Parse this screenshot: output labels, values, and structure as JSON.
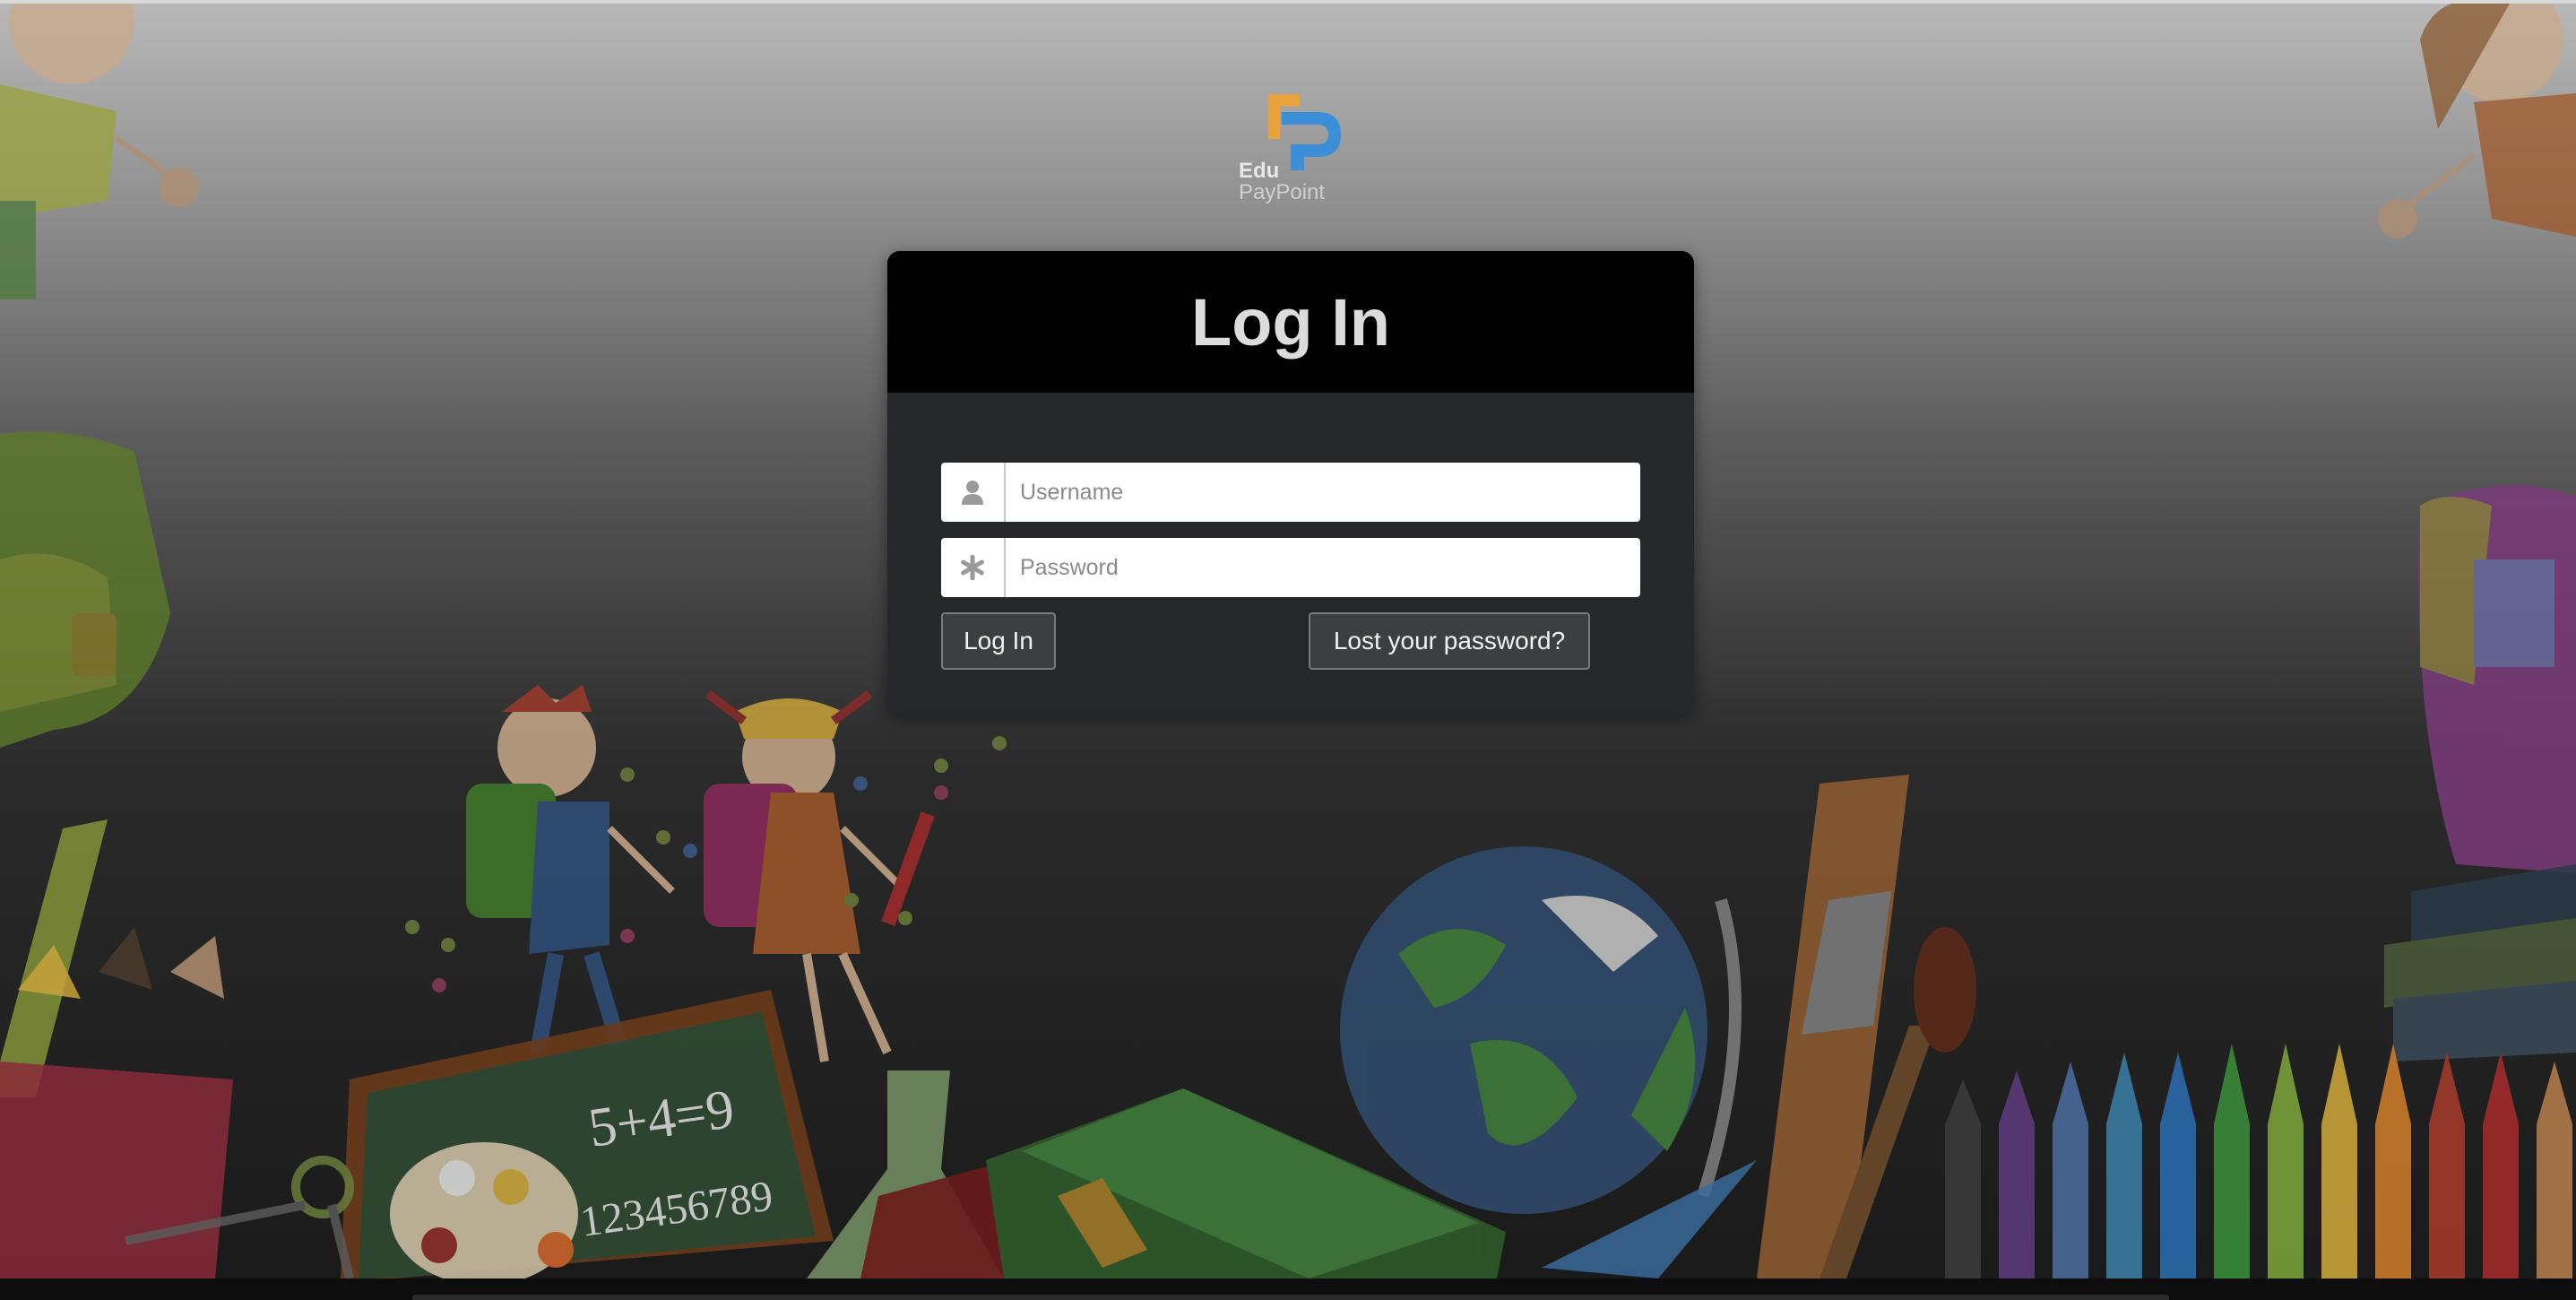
{
  "logo": {
    "line1": "Edu",
    "line2": "PayPoint",
    "colors": {
      "orange": "#e8a33a",
      "blue": "#3b8fd6"
    }
  },
  "login": {
    "title": "Log In",
    "username_placeholder": "Username",
    "password_placeholder": "Password",
    "submit_label": "Log In",
    "lost_password_label": "Lost your password?"
  },
  "chalkboard": {
    "equation": "5+4=9",
    "digits": "123456789"
  },
  "icons": {
    "username": "user-icon",
    "password": "asterisk-icon"
  },
  "colors": {
    "card_bg": "#25272b",
    "header_bg": "#000000",
    "button_bg": "#3c3e42"
  }
}
